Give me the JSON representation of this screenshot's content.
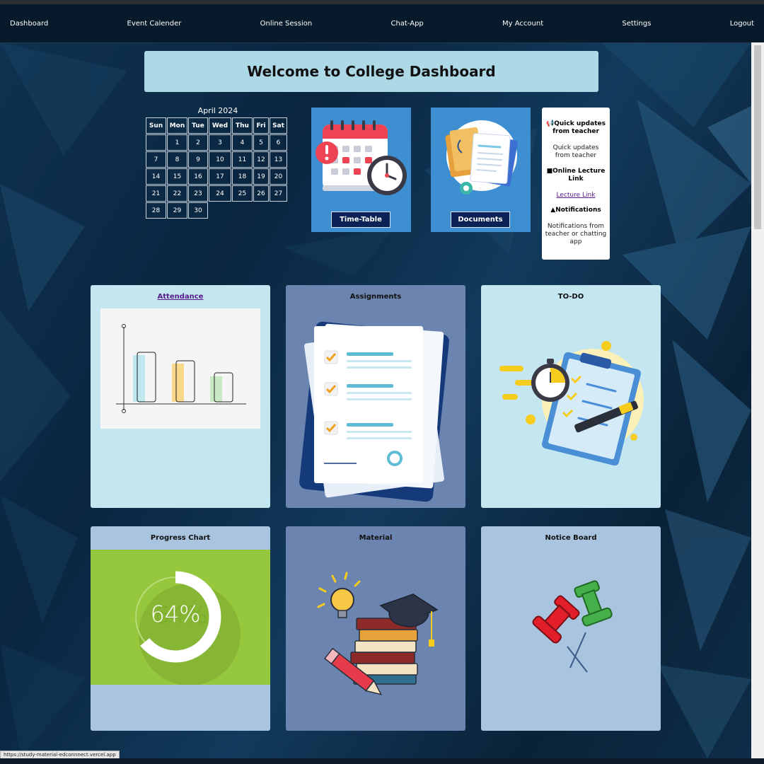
{
  "nav": {
    "items": [
      "Dashboard",
      "Event Calender",
      "Online Session",
      "Chat-App",
      "My Account",
      "Settings",
      "Logout"
    ]
  },
  "welcome": {
    "title": "Welcome to College Dashboard"
  },
  "calendar": {
    "title": "April 2024",
    "days": [
      "Sun",
      "Mon",
      "Tue",
      "Wed",
      "Thu",
      "Fri",
      "Sat"
    ],
    "weeks": [
      [
        "",
        "1",
        "2",
        "3",
        "4",
        "5",
        "6"
      ],
      [
        "7",
        "8",
        "9",
        "10",
        "11",
        "12",
        "13"
      ],
      [
        "14",
        "15",
        "16",
        "17",
        "18",
        "19",
        "20"
      ],
      [
        "21",
        "22",
        "23",
        "24",
        "25",
        "26",
        "27"
      ],
      [
        "28",
        "29",
        "30"
      ]
    ]
  },
  "tiles": {
    "timetable": {
      "button": "Time-Table",
      "icon": "calendar-clock-icon"
    },
    "documents": {
      "button": "Documents",
      "icon": "documents-icon"
    }
  },
  "updates": {
    "quick_heading": "Quick updates from teacher",
    "quick_text": "Quick updates from teacher",
    "lecture_heading": "Online Lecture Link",
    "lecture_link": "Lecture Link",
    "notif_heading": "Notifications",
    "notif_text": "Notifications from teacher or chatting app",
    "icons": [
      "megaphone-icon",
      "video-camera-icon",
      "bell-icon"
    ]
  },
  "cards": {
    "attendance": {
      "title": "Attendance",
      "bg": "#c4e6f0"
    },
    "assignments": {
      "title": "Assignments",
      "bg": "#6c85b0"
    },
    "todo": {
      "title": "TO-DO",
      "bg": "#c4e6f0"
    },
    "progress": {
      "title": "Progress Chart",
      "value": "64%",
      "percent": 64,
      "bg": "#a8c4de",
      "accent": "#95c83c"
    },
    "material": {
      "title": "Material",
      "bg": "#6c85b0"
    },
    "notice": {
      "title": "Notice Board",
      "bg": "#a8c4de"
    }
  },
  "status_url": "https://study-material-edconnnect.vercel.app"
}
